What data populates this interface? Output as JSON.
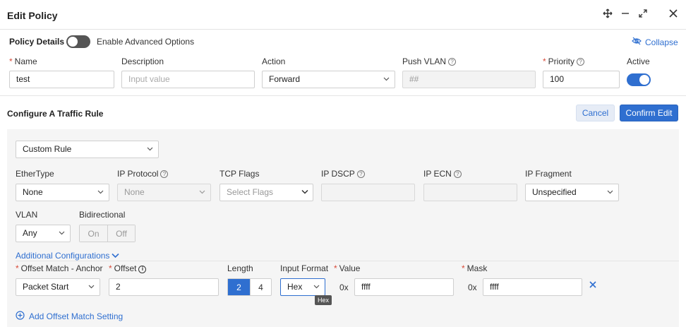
{
  "dialog": {
    "title": "Edit Policy",
    "icons": [
      "move-icon",
      "minimize-icon",
      "expand-icon",
      "close-icon"
    ]
  },
  "policy_details": {
    "title": "Policy Details",
    "advanced_toggle_on": false,
    "advanced_label": "Enable Advanced Options",
    "collapse_label": "Collapse"
  },
  "fields": {
    "name": {
      "label": "Name",
      "value": "test"
    },
    "description": {
      "label": "Description",
      "placeholder": "Input value"
    },
    "action": {
      "label": "Action",
      "value": "Forward"
    },
    "push_vlan": {
      "label": "Push VLAN",
      "placeholder": "##"
    },
    "priority": {
      "label": "Priority",
      "value": "100"
    },
    "active": {
      "label": "Active",
      "on": true
    }
  },
  "traffic_rule": {
    "title": "Configure A Traffic Rule",
    "cancel_label": "Cancel",
    "confirm_label": "Confirm Edit",
    "rule_type": "Custom Rule",
    "ethertype": {
      "label": "EtherType",
      "value": "None"
    },
    "ip_protocol": {
      "label": "IP Protocol",
      "value": "None"
    },
    "tcp_flags": {
      "label": "TCP Flags",
      "placeholder": "Select Flags"
    },
    "ip_dscp": {
      "label": "IP DSCP"
    },
    "ip_ecn": {
      "label": "IP ECN"
    },
    "ip_fragment": {
      "label": "IP Fragment",
      "value": "Unspecified"
    },
    "vlan": {
      "label": "VLAN",
      "value": "Any"
    },
    "bidirectional": {
      "label": "Bidirectional",
      "on_label": "On",
      "off_label": "Off"
    },
    "additional_label": "Additional Configurations",
    "offset_match": {
      "anchor_label": "Offset Match - Anchor",
      "anchor_value": "Packet Start",
      "offset_label": "Offset",
      "offset_value": "2",
      "length_label": "Length",
      "length_options": [
        "2",
        "4"
      ],
      "length_selected": "2",
      "input_format_label": "Input Format",
      "input_format_value": "Hex",
      "input_format_tooltip": "Hex",
      "value_label": "Value",
      "value_prefix": "0x",
      "value_value": "ffff",
      "mask_label": "Mask",
      "mask_prefix": "0x",
      "mask_value": "ffff"
    },
    "add_offset_label": "Add Offset Match Setting"
  },
  "colors": {
    "accent": "#2f6fd0",
    "required": "#d84a38",
    "panel_bg": "#f5f5f5"
  }
}
